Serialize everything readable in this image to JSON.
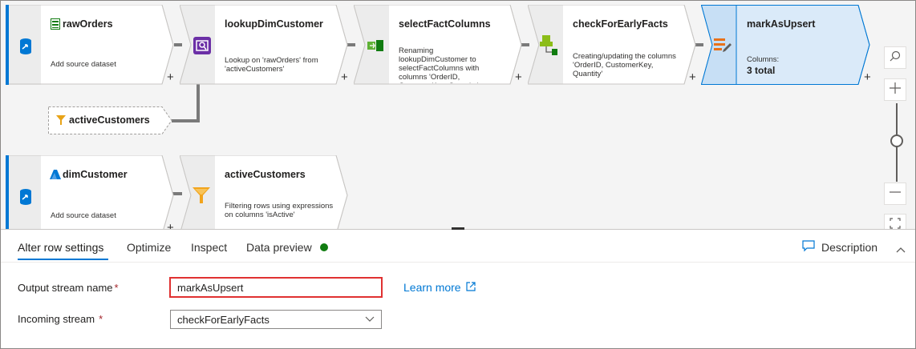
{
  "flow": {
    "nodes": [
      {
        "title": "rawOrders",
        "description": "Add source dataset",
        "icon": "source-db-icon",
        "title_icon": "dataset-icon"
      },
      {
        "title": "lookupDimCustomer",
        "description": "Lookup on 'rawOrders' from 'activeCustomers'",
        "icon": "lookup-icon"
      },
      {
        "title": "selectFactColumns",
        "description": "Renaming lookupDimCustomer to selectFactColumns with columns 'OrderID, CustomerKey, Quantity'",
        "icon": "select-icon"
      },
      {
        "title": "checkForEarlyFacts",
        "description": "Creating/updating the columns 'OrderID, CustomerKey, Quantity'",
        "icon": "derived-column-icon"
      },
      {
        "title": "markAsUpsert",
        "columns_label": "Columns:",
        "columns_value": "3 total",
        "icon": "alter-row-icon"
      },
      {
        "title": "dimCustomer",
        "description": "Add source dataset",
        "icon": "source-db-icon",
        "title_icon": "azure-sql-icon"
      },
      {
        "title": "activeCustomers",
        "description": "Filtering rows using expressions on columns 'isActive'",
        "icon": "filter-icon"
      }
    ],
    "reference": {
      "title": "activeCustomers",
      "icon": "filter-icon"
    },
    "plus": "+",
    "colors": {
      "accent": "#0078d4",
      "selected_fill": "#daeaf9",
      "connector": "#7a7a7a",
      "required": "#a4262c",
      "preview_dot": "#107c10",
      "highlight_border": "#e03131"
    }
  },
  "panel": {
    "tabs": [
      {
        "label": "Alter row settings",
        "active": true
      },
      {
        "label": "Optimize"
      },
      {
        "label": "Inspect"
      },
      {
        "label": "Data preview",
        "status": "preview-ready-dot"
      }
    ],
    "description_label": "Description",
    "form": {
      "output_label": "Output stream name",
      "output_value": "markAsUpsert",
      "learn_more": "Learn more",
      "incoming_label": "Incoming stream",
      "incoming_value": "checkForEarlyFacts",
      "required_mark": "*"
    }
  }
}
